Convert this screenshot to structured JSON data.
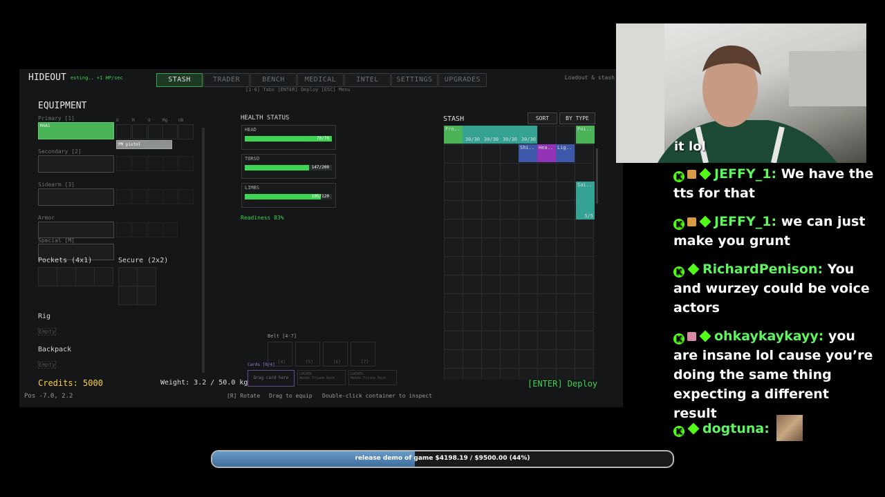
{
  "hud": {
    "title": "HIDEOUT",
    "status": "esting.. +1 HP/sec",
    "subtitle_right": "Loadout & stash",
    "hint_tabs": "[1-6] Tabs  [ENTER] Deploy  [ESC] Menu",
    "tabs": [
      "STASH",
      "TRADER",
      "BENCH",
      "MEDICAL",
      "INTEL",
      "SETTINGS",
      "UPGRADES"
    ],
    "active_tab": "STASH"
  },
  "equipment": {
    "heading": "EQUIPMENT",
    "primary_label": "Primary [1]",
    "primary_item": "M4A1",
    "secondary_label": "Secondary [2]",
    "sidearm_label": "Sidearm [3]",
    "armor_label": "Armor",
    "special_label": "Special [M]",
    "pockets_label": "Pockets (4x1)",
    "secure_label": "Secure (2x2)",
    "rig_label": "Rig",
    "rig_value": "Empty",
    "backpack_label": "Backpack",
    "backpack_value": "Empty",
    "mod_columns": [
      "O",
      "M",
      "O",
      "Mg",
      "UB"
    ],
    "tooltip_item": "PM pistol",
    "credits": "Credits: 5000",
    "weight": "Weight: 3.2 / 50.0 kg",
    "pos": "Pos -7.0, 2.2"
  },
  "health": {
    "heading": "HEALTH STATUS",
    "parts": [
      {
        "name": "HEAD",
        "value": "70/70",
        "fill": 1.0
      },
      {
        "name": "TORSO",
        "value": "147/200",
        "fill": 0.735
      },
      {
        "name": "LIMBS",
        "value": "105/120",
        "fill": 0.875
      }
    ],
    "readiness": "Readiness 83%"
  },
  "stash": {
    "heading": "STASH",
    "sort_label": "SORT",
    "bytype_label": "BY TYPE",
    "items": [
      "Fro..",
      "30/30",
      "30/30",
      "30/30",
      "30/30",
      "Poi..",
      "Shi..",
      "Hea..",
      "Lig..",
      "Sai..",
      "5/5"
    ]
  },
  "belt": {
    "label": "Belt [4-7]",
    "slots": [
      "[4]",
      "[5]",
      "[6]",
      "[7]"
    ],
    "cards_label": "Cards [0/4]",
    "drag_card": "Drag card here",
    "locked1": "LOCKED",
    "locked_sub1": "Needs Triune Deck",
    "locked2": "LOCKED",
    "locked_sub2": "Needs Triune Deck"
  },
  "footer": {
    "deploy": "[ENTER] Deploy",
    "rotate": "[R] Rotate",
    "drag": "Drag to equip",
    "inspect": "Double-click container to inspect"
  },
  "webcam": {
    "caption": "it lol"
  },
  "chat": [
    {
      "user": "JEFFY_1:",
      "text": "We have the tts for that",
      "gift": true
    },
    {
      "user": "JEFFY_1:",
      "text": "we can just make you grunt",
      "gift": true
    },
    {
      "user": "RichardPenison:",
      "text": "You and wurzey could be voice actors",
      "gift": false
    },
    {
      "user": "ohkaykaykayy:",
      "text": "you are insane lol cause you’re doing the same thing expecting a different result",
      "gift": true
    },
    {
      "user": "dogtuna:",
      "text": "",
      "gift": false
    }
  ],
  "goal": {
    "text": "release demo of game $4198.19 / $9500.00 (44%)",
    "progress": 0.44
  },
  "colors": {
    "accent_green": "#3fd353",
    "chat_name": "#5ff55f",
    "kick_green": "#53fc18"
  }
}
